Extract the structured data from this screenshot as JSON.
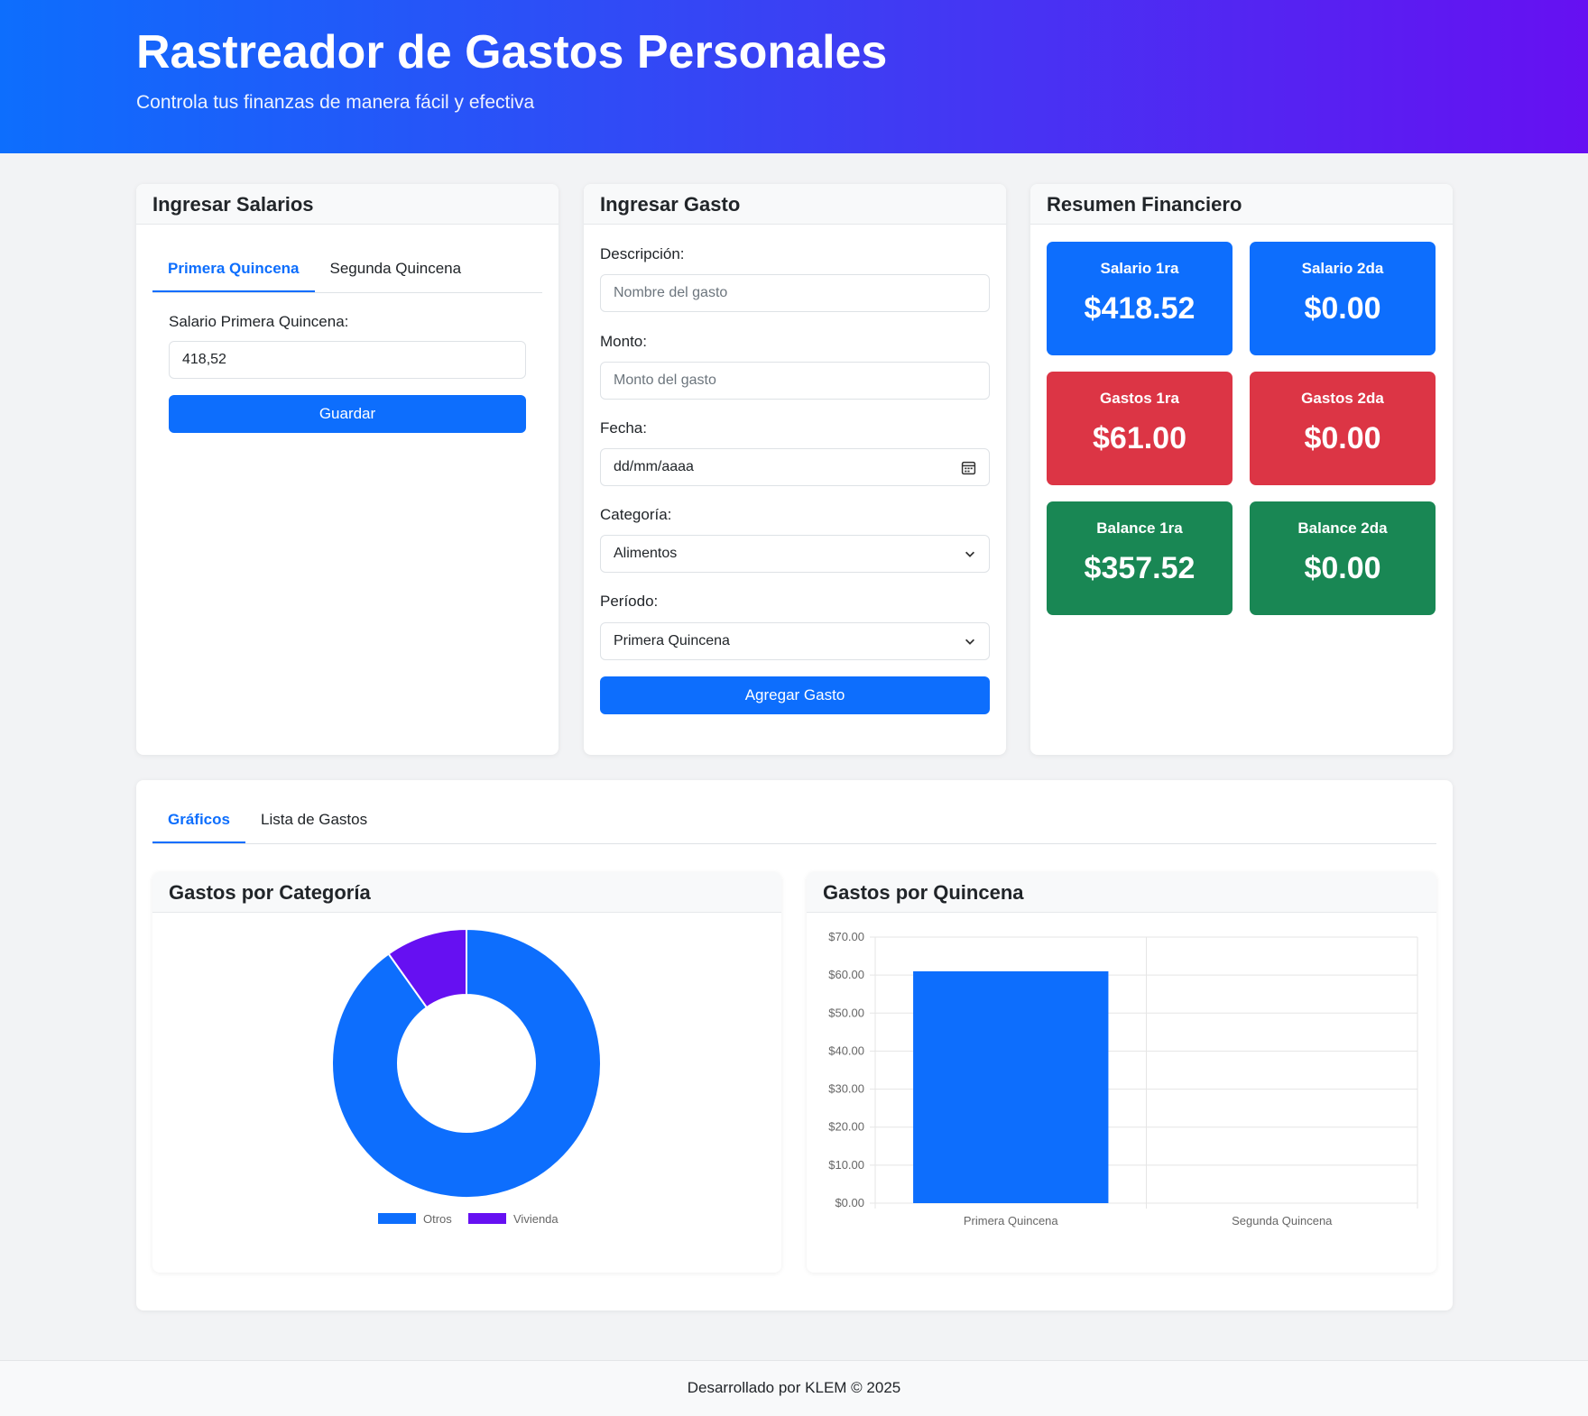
{
  "header": {
    "title": "Rastreador de Gastos Personales",
    "subtitle": "Controla tus finanzas de manera fácil y efectiva"
  },
  "salaries": {
    "title": "Ingresar Salarios",
    "tabs": [
      "Primera Quincena",
      "Segunda Quincena"
    ],
    "active_tab": 0,
    "field_label": "Salario Primera Quincena:",
    "field_value": "418,52",
    "save_label": "Guardar"
  },
  "expense": {
    "title": "Ingresar Gasto",
    "description_label": "Descripción:",
    "description_placeholder": "Nombre del gasto",
    "amount_label": "Monto:",
    "amount_placeholder": "Monto del gasto",
    "date_label": "Fecha:",
    "date_placeholder": "dd/mm/aaaa",
    "category_label": "Categoría:",
    "category_value": "Alimentos",
    "period_label": "Período:",
    "period_value": "Primera Quincena",
    "add_label": "Agregar Gasto"
  },
  "summary": {
    "title": "Resumen Financiero",
    "cards": [
      {
        "label": "Salario 1ra",
        "value": "$418.52",
        "color": "#0d6efd"
      },
      {
        "label": "Salario 2da",
        "value": "$0.00",
        "color": "#0d6efd"
      },
      {
        "label": "Gastos 1ra",
        "value": "$61.00",
        "color": "#dc3545"
      },
      {
        "label": "Gastos 2da",
        "value": "$0.00",
        "color": "#dc3545"
      },
      {
        "label": "Balance 1ra",
        "value": "$357.52",
        "color": "#198754"
      },
      {
        "label": "Balance 2da",
        "value": "$0.00",
        "color": "#198754"
      }
    ]
  },
  "bottom_tabs": [
    "Gráficos",
    "Lista de Gastos"
  ],
  "bottom_active_tab": 0,
  "category_chart_title": "Gastos por Categoría",
  "period_chart_title": "Gastos por Quincena",
  "chart_data": [
    {
      "type": "pie",
      "title": "Gastos por Categoría",
      "categories": [
        "Otros",
        "Vivienda"
      ],
      "values": [
        55,
        6
      ],
      "colors": [
        "#0d6efd",
        "#6610f2"
      ],
      "legend": "bottom"
    },
    {
      "type": "bar",
      "title": "Gastos por Quincena",
      "categories": [
        "Primera Quincena",
        "Segunda Quincena"
      ],
      "values": [
        61,
        0
      ],
      "ylim": [
        0,
        70
      ],
      "yticks": [
        "$0.00",
        "$10.00",
        "$20.00",
        "$30.00",
        "$40.00",
        "$50.00",
        "$60.00",
        "$70.00"
      ],
      "color": "#0d6efd",
      "grid": true
    }
  ],
  "footer": {
    "text": "Desarrollado por KLEM © 2025"
  }
}
